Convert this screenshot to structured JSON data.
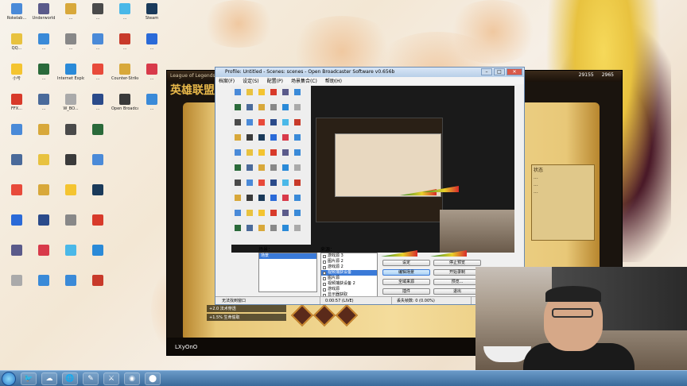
{
  "desktop": {
    "icons": [
      {
        "label": "Rokelab...",
        "color": "#4a8ad8"
      },
      {
        "label": "QQ...",
        "color": "#e8c23f"
      },
      {
        "label": "小号",
        "color": "#f4c430"
      },
      {
        "label": "FFX...",
        "color": "#d83a2a"
      },
      {
        "label": "Underworld",
        "color": "#5a5a8a"
      },
      {
        "label": "...",
        "color": "#3a8ad8"
      },
      {
        "label": "...",
        "color": "#2a6a3a"
      },
      {
        "label": "...",
        "color": "#4a6a9a"
      },
      {
        "label": "...",
        "color": "#d8a83a"
      },
      {
        "label": "...",
        "color": "#888"
      },
      {
        "label": "Internet Explorer",
        "color": "#2a8ad8"
      },
      {
        "label": "W_BO...",
        "color": "#aaa"
      },
      {
        "label": "...",
        "color": "#4a4a4a"
      },
      {
        "label": "...",
        "color": "#4a8ad8"
      },
      {
        "label": "...",
        "color": "#e84a3a"
      },
      {
        "label": "...",
        "color": "#2a4a8a"
      },
      {
        "label": "...",
        "color": "#4ab8e8"
      },
      {
        "label": "...",
        "color": "#c83a2a"
      },
      {
        "label": "Counter-Strike",
        "color": "#d8a83a"
      },
      {
        "label": "Open Broadcaster",
        "color": "#3a3a3a"
      },
      {
        "label": "Steam",
        "color": "#1a3a5a"
      },
      {
        "label": "...",
        "color": "#2a6ad8"
      },
      {
        "label": "...",
        "color": "#d83a4a"
      },
      {
        "label": "...",
        "color": "#3a8ad8"
      }
    ]
  },
  "lol_client": {
    "title": "League of Legends 8.24",
    "logo": "英雄联盟",
    "rp": "29155",
    "ip": "2965",
    "status_heading": "状态",
    "status_rows": [
      "...",
      "...",
      "..."
    ],
    "summoner": "LXyOnO",
    "list_items": [
      "+2.0 法术穿透",
      "+1.5% 生命偷取"
    ]
  },
  "obs": {
    "title": "Profile: Untitled - Scenes: scenes - Open Broadcaster Software v0.656b",
    "menu": [
      "档案(F)",
      "设定(S)",
      "配置(P)",
      "场景集合(C)",
      "帮助(H)"
    ],
    "scenes_label": "场景：",
    "sources_label": "来源：",
    "scenes": [
      "场景"
    ],
    "sources": [
      {
        "label": "游戏源 3",
        "selected": false
      },
      {
        "label": "图片源 2",
        "selected": false
      },
      {
        "label": "游戏源 2",
        "selected": false
      },
      {
        "label": "视频捕获设备",
        "selected": true
      },
      {
        "label": "图片源",
        "selected": false
      },
      {
        "label": "视频捕获设备 2",
        "selected": false
      },
      {
        "label": "游戏源",
        "selected": false
      },
      {
        "label": "显示器获取",
        "selected": false
      }
    ],
    "buttons": {
      "settings": "设定",
      "stop_preview": "停止预览",
      "edit_scene": "编辑场景",
      "start_recording": "开始录制",
      "global_sources": "全域来源",
      "preview": "预览...",
      "plugins": "插件",
      "exit": "退出"
    },
    "status": {
      "message": "无法找到窗口",
      "time": "0:00:57 (LIVE)",
      "dropped": "丢失帧数: 0 (0.00%)",
      "fps": "FPS"
    }
  },
  "taskbar": {
    "apps": [
      "🐦",
      "☁",
      "🌐",
      "✎",
      "⚔",
      "◉",
      "⬤"
    ]
  }
}
